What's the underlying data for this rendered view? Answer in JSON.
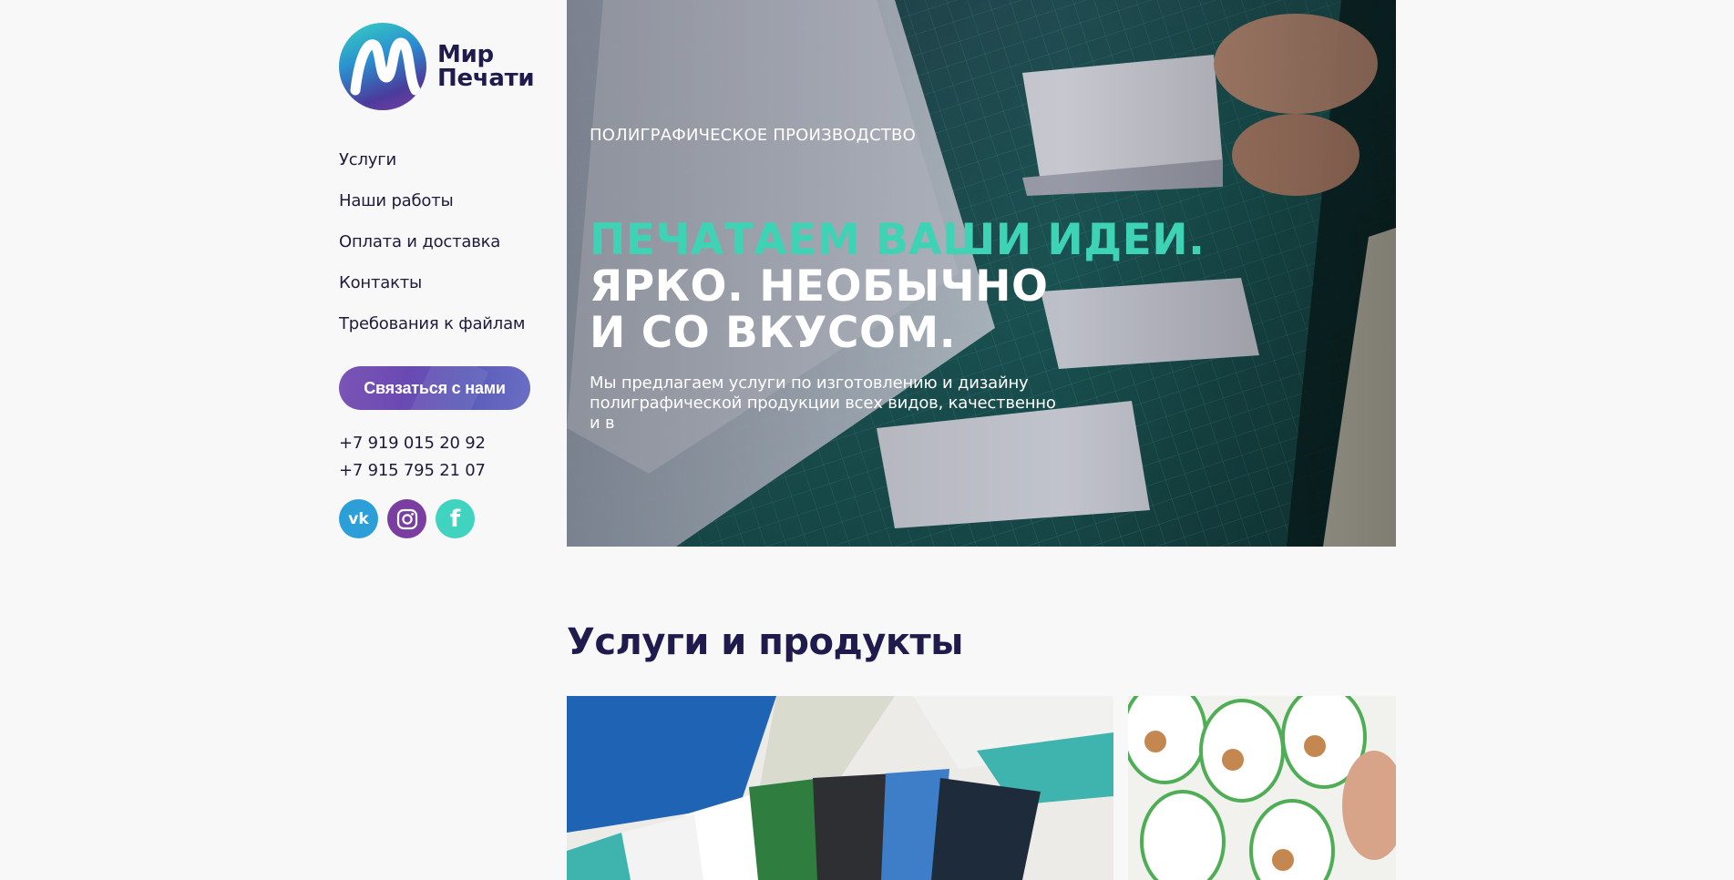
{
  "brand": {
    "line1": "Мир",
    "line2": "Печати"
  },
  "nav": {
    "items": [
      {
        "label": "Услуги"
      },
      {
        "label": "Наши работы"
      },
      {
        "label": "Оплата и доставка"
      },
      {
        "label": "Контакты"
      },
      {
        "label": "Требования к файлам"
      }
    ]
  },
  "contact_button": "Связаться с нами",
  "phones": [
    "+7 919 015 20 92",
    "+7 915 795 21 07"
  ],
  "socials": [
    {
      "icon": "vk-icon",
      "label": "vk"
    },
    {
      "icon": "instagram-icon"
    },
    {
      "icon": "facebook-icon",
      "label": "f"
    }
  ],
  "hero": {
    "eyebrow": "ПОЛИГРАФИЧЕСКОЕ ПРОИЗВОДСТВО",
    "headline_accent": "ПЕЧАТАЕМ ВАШИ ИДЕИ.",
    "headline_line2": "ЯРКО. НЕОБЫЧНО",
    "headline_line3": "И СО ВКУСОМ.",
    "description": "Мы предлагаем услуги по изготовлению и дизайну полиграфической продукции всех видов, качественно и в"
  },
  "services": {
    "title": "Услуги и продукты"
  },
  "colors": {
    "accent_teal": "#3fd3b6",
    "brand_purple": "#6a4ab2",
    "heading_navy": "#1f1b4d",
    "background": "#f8f8f8"
  }
}
